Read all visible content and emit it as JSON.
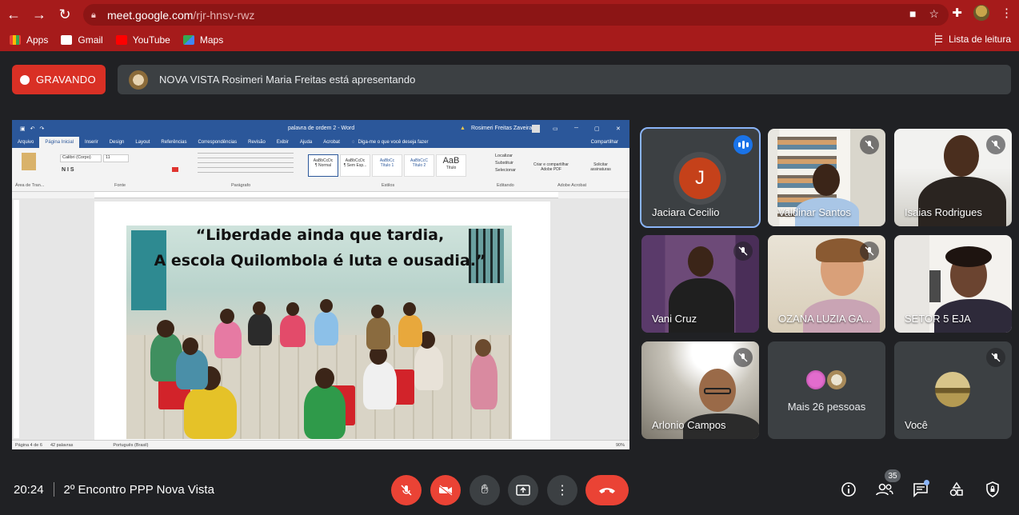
{
  "browser": {
    "url_host": "meet.google.com",
    "url_path": "/rjr-hnsv-rwz",
    "bookmarks": [
      "Apps",
      "Gmail",
      "YouTube",
      "Maps"
    ],
    "reading_list": "Lista de leitura"
  },
  "meet": {
    "recording_label": "GRAVANDO",
    "presenting_text": "NOVA VISTA Rosimeri Maria Freitas está apresentando",
    "time": "20:24",
    "meeting_title": "2º Encontro PPP Nova Vista",
    "participant_count": "35"
  },
  "shared_screen": {
    "word_title": "palavra de ordem 2  -  Word",
    "word_search": "Diga-me o que você deseja fazer",
    "word_user": "Rosimeri Freitas Zaveira",
    "tabs": [
      "Arquivo",
      "Página Inicial",
      "Inserir",
      "Design",
      "Layout",
      "Referências",
      "Correspondências",
      "Revisão",
      "Exibir",
      "Ajuda",
      "Acrobat"
    ],
    "share_label": "Compartilhar",
    "font_name": "Calibri (Corpo)",
    "font_size": "11",
    "styles": [
      "AaBbCcDc",
      "AaBbCcDc",
      "AaBbCc",
      "AaBbCcC",
      "AaB"
    ],
    "style_names": [
      "¶ Normal",
      "¶ Sem Esp...",
      "Título 1",
      "Título 2",
      "Título"
    ],
    "ribbon_groups": [
      "Área de Tran...",
      "Fonte",
      "Parágrafo",
      "Estilos",
      "Editando",
      "Adobe Acrobat"
    ],
    "editing": [
      "Localizar",
      "Substituir",
      "Selecionar"
    ],
    "acrobat": [
      "Criar e compartilhar Adobe PDF",
      "Solicitar assinaturas"
    ],
    "quote_line1": "“Liberdade ainda que tardia,",
    "quote_line2": "A escola Quilombola é luta e ousadia.”",
    "status_page": "Página 4 de 6",
    "status_words": "42 palavras",
    "status_lang": "Português (Brasil)",
    "zoom": "90%"
  },
  "participants": [
    {
      "name": "Jaciara Cecilio",
      "initial": "J"
    },
    {
      "name": "Valdinar Santos"
    },
    {
      "name": "Isaias Rodrigues"
    },
    {
      "name": "Vani Cruz"
    },
    {
      "name": "OZANA LUZIA GA..."
    },
    {
      "name": "SETOR 5 EJA"
    },
    {
      "name": "Arlonio Campos"
    },
    {
      "name": "Mais 26 pessoas"
    },
    {
      "name": "Você"
    }
  ],
  "colors": {
    "chrome": "#a61b1b",
    "recording": "#d93025",
    "accent": "#8ab4f8",
    "control_red": "#ea4335",
    "meet_bg": "#202124",
    "tile_bg": "#3c4043"
  }
}
